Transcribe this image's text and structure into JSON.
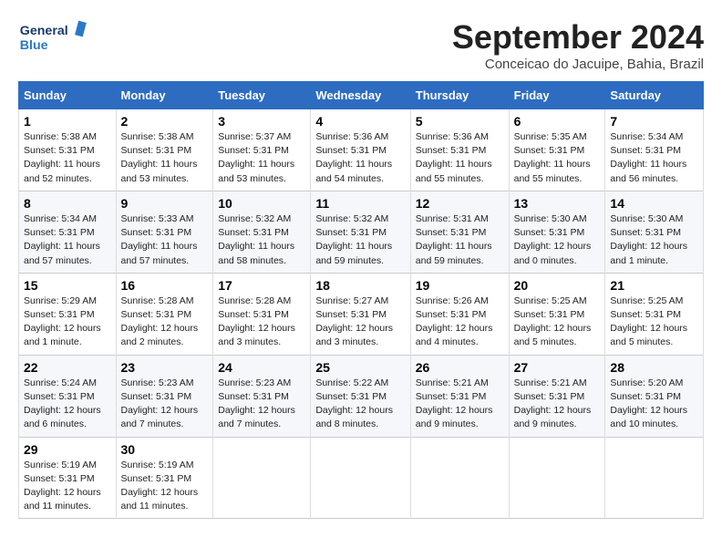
{
  "header": {
    "logo_general": "General",
    "logo_blue": "Blue",
    "month_title": "September 2024",
    "location": "Conceicao do Jacuipe, Bahia, Brazil"
  },
  "weekdays": [
    "Sunday",
    "Monday",
    "Tuesday",
    "Wednesday",
    "Thursday",
    "Friday",
    "Saturday"
  ],
  "weeks": [
    [
      {
        "day": "1",
        "sunrise": "5:38 AM",
        "sunset": "5:31 PM",
        "daylight": "11 hours and 52 minutes."
      },
      {
        "day": "2",
        "sunrise": "5:38 AM",
        "sunset": "5:31 PM",
        "daylight": "11 hours and 53 minutes."
      },
      {
        "day": "3",
        "sunrise": "5:37 AM",
        "sunset": "5:31 PM",
        "daylight": "11 hours and 53 minutes."
      },
      {
        "day": "4",
        "sunrise": "5:36 AM",
        "sunset": "5:31 PM",
        "daylight": "11 hours and 54 minutes."
      },
      {
        "day": "5",
        "sunrise": "5:36 AM",
        "sunset": "5:31 PM",
        "daylight": "11 hours and 55 minutes."
      },
      {
        "day": "6",
        "sunrise": "5:35 AM",
        "sunset": "5:31 PM",
        "daylight": "11 hours and 55 minutes."
      },
      {
        "day": "7",
        "sunrise": "5:34 AM",
        "sunset": "5:31 PM",
        "daylight": "11 hours and 56 minutes."
      }
    ],
    [
      {
        "day": "8",
        "sunrise": "5:34 AM",
        "sunset": "5:31 PM",
        "daylight": "11 hours and 57 minutes."
      },
      {
        "day": "9",
        "sunrise": "5:33 AM",
        "sunset": "5:31 PM",
        "daylight": "11 hours and 57 minutes."
      },
      {
        "day": "10",
        "sunrise": "5:32 AM",
        "sunset": "5:31 PM",
        "daylight": "11 hours and 58 minutes."
      },
      {
        "day": "11",
        "sunrise": "5:32 AM",
        "sunset": "5:31 PM",
        "daylight": "11 hours and 59 minutes."
      },
      {
        "day": "12",
        "sunrise": "5:31 AM",
        "sunset": "5:31 PM",
        "daylight": "11 hours and 59 minutes."
      },
      {
        "day": "13",
        "sunrise": "5:30 AM",
        "sunset": "5:31 PM",
        "daylight": "12 hours and 0 minutes."
      },
      {
        "day": "14",
        "sunrise": "5:30 AM",
        "sunset": "5:31 PM",
        "daylight": "12 hours and 1 minute."
      }
    ],
    [
      {
        "day": "15",
        "sunrise": "5:29 AM",
        "sunset": "5:31 PM",
        "daylight": "12 hours and 1 minute."
      },
      {
        "day": "16",
        "sunrise": "5:28 AM",
        "sunset": "5:31 PM",
        "daylight": "12 hours and 2 minutes."
      },
      {
        "day": "17",
        "sunrise": "5:28 AM",
        "sunset": "5:31 PM",
        "daylight": "12 hours and 3 minutes."
      },
      {
        "day": "18",
        "sunrise": "5:27 AM",
        "sunset": "5:31 PM",
        "daylight": "12 hours and 3 minutes."
      },
      {
        "day": "19",
        "sunrise": "5:26 AM",
        "sunset": "5:31 PM",
        "daylight": "12 hours and 4 minutes."
      },
      {
        "day": "20",
        "sunrise": "5:25 AM",
        "sunset": "5:31 PM",
        "daylight": "12 hours and 5 minutes."
      },
      {
        "day": "21",
        "sunrise": "5:25 AM",
        "sunset": "5:31 PM",
        "daylight": "12 hours and 5 minutes."
      }
    ],
    [
      {
        "day": "22",
        "sunrise": "5:24 AM",
        "sunset": "5:31 PM",
        "daylight": "12 hours and 6 minutes."
      },
      {
        "day": "23",
        "sunrise": "5:23 AM",
        "sunset": "5:31 PM",
        "daylight": "12 hours and 7 minutes."
      },
      {
        "day": "24",
        "sunrise": "5:23 AM",
        "sunset": "5:31 PM",
        "daylight": "12 hours and 7 minutes."
      },
      {
        "day": "25",
        "sunrise": "5:22 AM",
        "sunset": "5:31 PM",
        "daylight": "12 hours and 8 minutes."
      },
      {
        "day": "26",
        "sunrise": "5:21 AM",
        "sunset": "5:31 PM",
        "daylight": "12 hours and 9 minutes."
      },
      {
        "day": "27",
        "sunrise": "5:21 AM",
        "sunset": "5:31 PM",
        "daylight": "12 hours and 9 minutes."
      },
      {
        "day": "28",
        "sunrise": "5:20 AM",
        "sunset": "5:31 PM",
        "daylight": "12 hours and 10 minutes."
      }
    ],
    [
      {
        "day": "29",
        "sunrise": "5:19 AM",
        "sunset": "5:31 PM",
        "daylight": "12 hours and 11 minutes."
      },
      {
        "day": "30",
        "sunrise": "5:19 AM",
        "sunset": "5:31 PM",
        "daylight": "12 hours and 11 minutes."
      },
      null,
      null,
      null,
      null,
      null
    ]
  ]
}
